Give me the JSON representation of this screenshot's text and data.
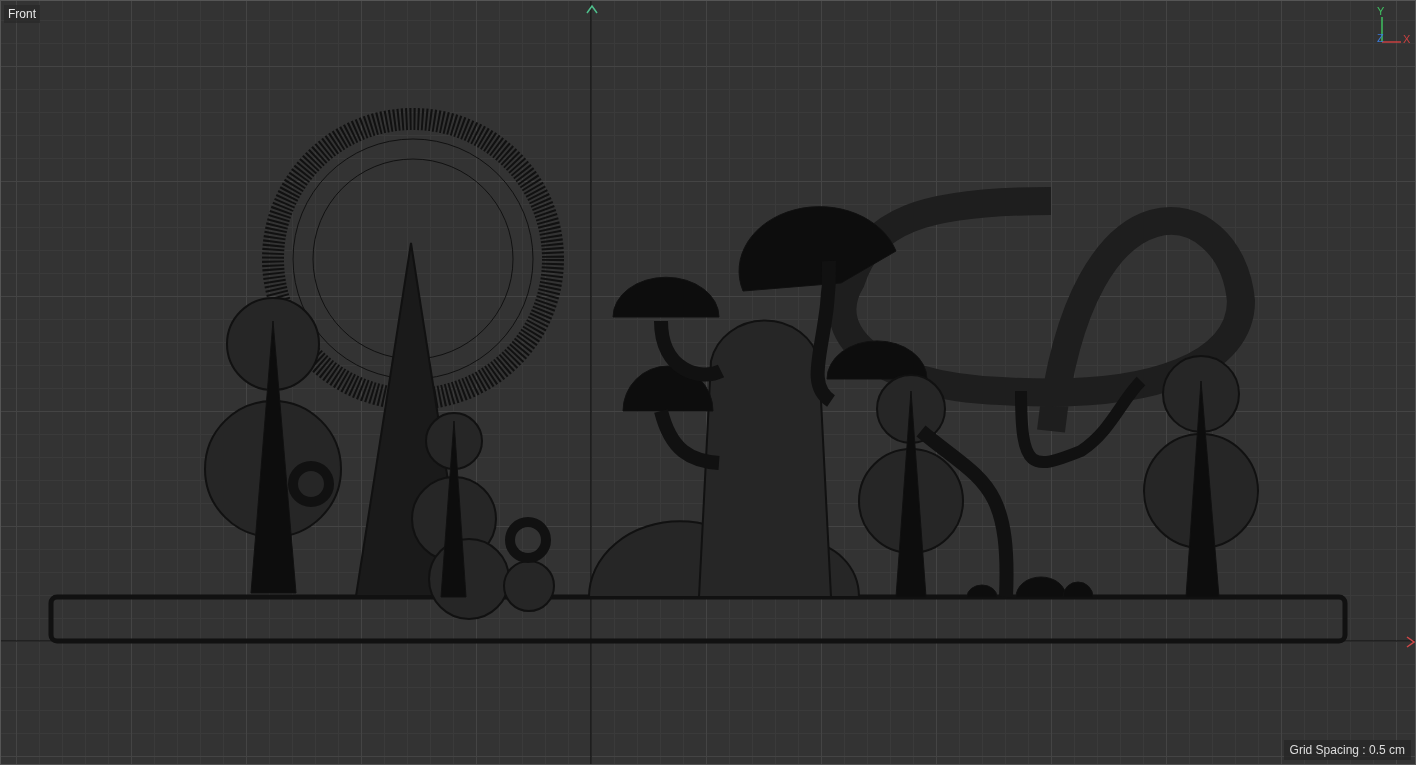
{
  "viewport": {
    "title": "Front",
    "axes": {
      "y": "Y",
      "z": "Z",
      "x": "X"
    },
    "status": "Grid Spacing : 0.5 cm"
  }
}
